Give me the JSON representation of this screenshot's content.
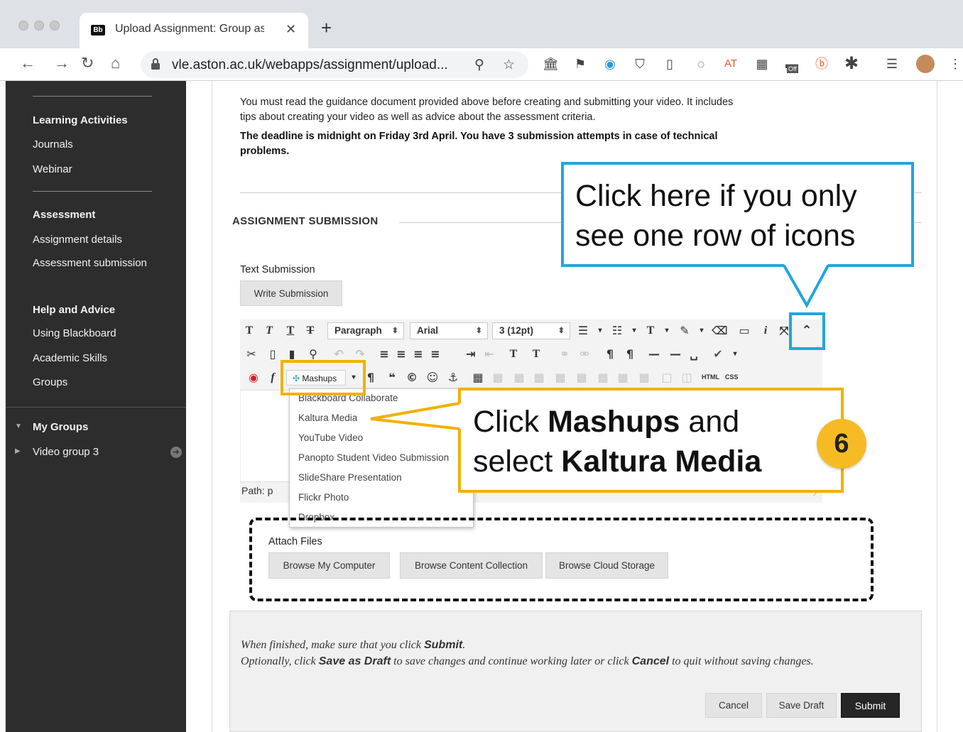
{
  "browser": {
    "tab_title": "Upload Assignment: Group ass",
    "tab_favicon": "Bb",
    "url": "vle.aston.ac.uk/webapps/assignment/upload...",
    "extension_badge_off": "Off",
    "extension_at": "AT"
  },
  "sidebar": {
    "sections": [
      {
        "heading": "Learning Activities",
        "items": [
          "Journals",
          "Webinar"
        ]
      },
      {
        "heading": "Assessment",
        "items": [
          "Assignment details",
          "Assessment submission"
        ]
      },
      {
        "heading": "Help and Advice",
        "items": [
          "Using Blackboard",
          "Academic Skills",
          "Groups"
        ]
      }
    ],
    "my_groups": {
      "heading": "My Groups",
      "items": [
        "Video group 3"
      ]
    }
  },
  "main": {
    "guidance": "You must read the guidance document provided above before creating and submitting your video. It includes tips about creating your video as well as advice about the assessment criteria.",
    "deadline": "The deadline is midnight on Friday 3rd April. You have 3 submission attempts in case of technical problems.",
    "section_title": "ASSIGNMENT SUBMISSION",
    "text_submission_label": "Text Submission",
    "write_submission_button": "Write Submission",
    "editor": {
      "paragraph_select": "Paragraph",
      "font_select": "Arial",
      "size_select": "3 (12pt)",
      "mashups_label": "Mashups",
      "path_label": "Path: p",
      "html_label": "HTML",
      "css_label": "CSS"
    },
    "mashups_menu": [
      "Blackboard Collaborate",
      "Kaltura Media",
      "YouTube Video",
      "Panopto Student Video Submission",
      "SlideShare Presentation",
      "Flickr Photo",
      "Dropbox"
    ],
    "attach_files_label": "Attach Files",
    "attach_buttons": [
      "Browse My Computer",
      "Browse Content Collection",
      "Browse Cloud Storage"
    ],
    "finish_note_1": {
      "pre": "When finished, make sure that you click ",
      "bold": "Submit",
      "post": "."
    },
    "finish_note_2": {
      "pre": "Optionally, click ",
      "bold1": "Save as Draft",
      "mid": " to save changes and continue working later or click ",
      "bold2": "Cancel",
      "post": " to quit without saving changes."
    },
    "buttons": {
      "cancel": "Cancel",
      "save_draft": "Save Draft",
      "submit": "Submit"
    }
  },
  "annotations": {
    "blue_callout": "Click here if you only see one row of icons",
    "yellow_callout": {
      "pre": "Click ",
      "bold1": "Mashups",
      "mid": " and select ",
      "bold2": "Kaltura Media"
    },
    "step_number": "6",
    "colors": {
      "blue": "#21a6dc",
      "yellow": "#f2b100",
      "badge": "#f6bb24"
    }
  }
}
